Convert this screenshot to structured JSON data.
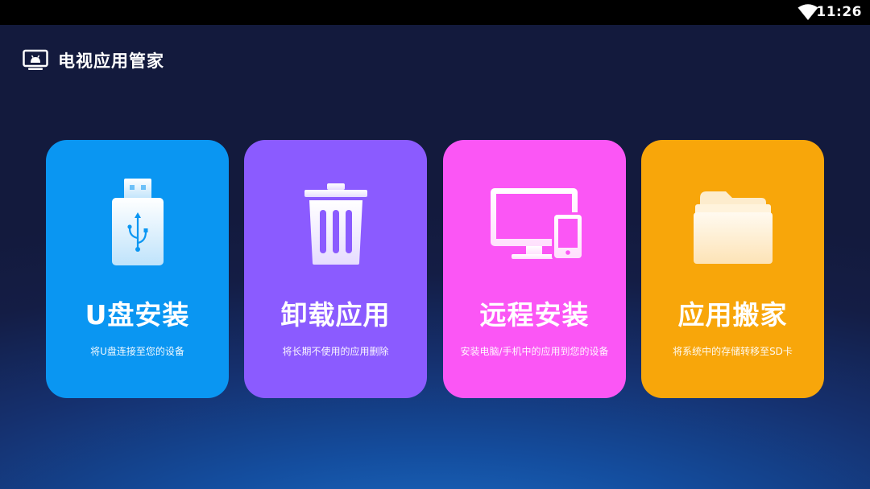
{
  "status_bar": {
    "time": "11:26",
    "wifi_icon": "wifi-icon"
  },
  "header": {
    "icon": "tv-icon",
    "title": "电视应用管家"
  },
  "cards": [
    {
      "title": "U盘安装",
      "description": "将U盘连接至您的设备",
      "icon": "usb-drive-icon",
      "color": "#0a96f2"
    },
    {
      "title": "卸载应用",
      "description": "将长期不使用的应用删除",
      "icon": "trash-icon",
      "color": "#8b5bff"
    },
    {
      "title": "远程安装",
      "description": "安装电脑/手机中的应用到您的设备",
      "icon": "monitor-phone-icon",
      "color": "#fb56f5"
    },
    {
      "title": "应用搬家",
      "description": "将系统中的存储转移至SD卡",
      "icon": "folder-icon",
      "color": "#f8a60a"
    }
  ]
}
